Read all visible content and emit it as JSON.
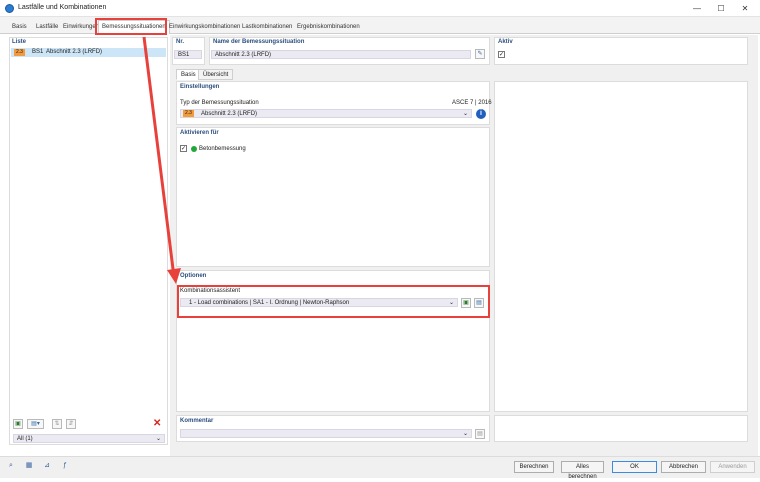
{
  "window": {
    "title": "Lastfälle und Kombinationen",
    "min_glyph": "—",
    "max_glyph": "☐",
    "close_glyph": "✕"
  },
  "tabs": [
    {
      "label": "Basis"
    },
    {
      "label": "Lastfälle"
    },
    {
      "label": "Einwirkungen"
    },
    {
      "label": "Bemessungssituationen"
    },
    {
      "label": "Einwirkungskombinationen"
    },
    {
      "label": "Lastkombinationen"
    },
    {
      "label": "Ergebniskombinationen"
    }
  ],
  "left": {
    "title": "Liste",
    "items": [
      {
        "badge": "2.3",
        "code": "BS1",
        "label": "Abschnitt 2.3 (LRFD)"
      }
    ],
    "filter_value": "All (1)",
    "delete_glyph": "✕"
  },
  "header": {
    "nr_label": "Nr.",
    "nr_value": "BS1",
    "name_label": "Name der Bemessungssituation",
    "name_value": "Abschnitt 2.3 (LRFD)",
    "active_label": "Aktiv",
    "active_checked": "✓"
  },
  "subtabs": [
    {
      "label": "Basis"
    },
    {
      "label": "Übersicht"
    }
  ],
  "settings": {
    "title": "Einstellungen",
    "type_label": "Typ der Bemessungssituation",
    "standard": "ASCE 7 | 2016",
    "type_badge": "2.3",
    "type_value": "Abschnitt 2.3 (LRFD)",
    "info_glyph": "i"
  },
  "activate": {
    "title": "Aktivieren für",
    "item_label": "Betonbemessung",
    "item_checked": "✓",
    "dot_color": "#22a838"
  },
  "options": {
    "title": "Optionen",
    "wizard_label": "Kombinationsassistent",
    "wizard_value": "1 - Load combinations | SA1 - I. Ordnung | Newton-Raphson"
  },
  "comment": {
    "title": "Kommentar"
  },
  "footer": {
    "calc": "Berechnen",
    "calc_all": "Alles berechnen",
    "ok": "OK",
    "cancel": "Abbrechen",
    "apply": "Anwenden"
  },
  "highlight_color": "#e8403a"
}
